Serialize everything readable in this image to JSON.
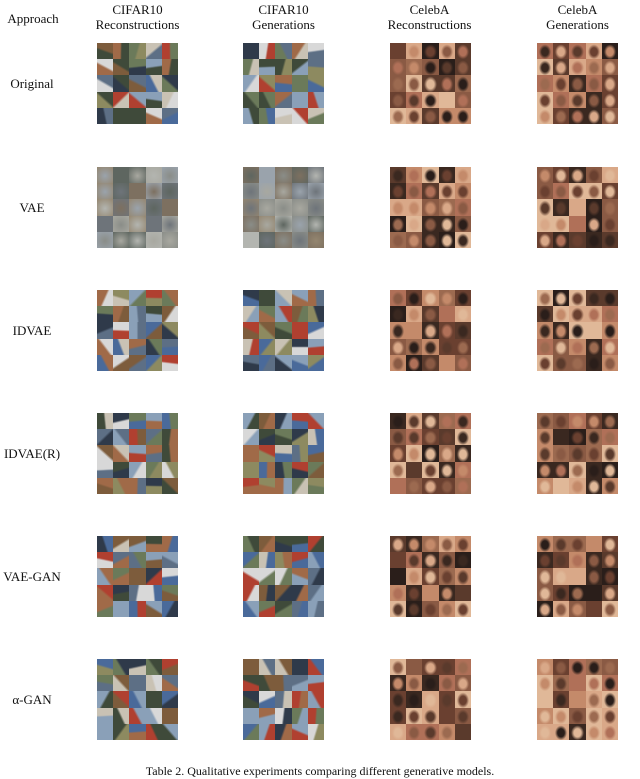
{
  "table": {
    "caption": "Table 2. Qualitative experiments comparing different generative models.",
    "headers": {
      "approach": "Approach",
      "columns": [
        {
          "line1": "CIFAR10",
          "line2": "Reconstructions"
        },
        {
          "line1": "CIFAR10",
          "line2": "Generations"
        },
        {
          "line1": "CelebA",
          "line2": "Reconstructions"
        },
        {
          "line1": "CelebA",
          "line2": "Generations"
        }
      ]
    },
    "rows": [
      {
        "label": "Original"
      },
      {
        "label": "VAE"
      },
      {
        "label": "IDVAE"
      },
      {
        "label": "IDVAE(R)"
      },
      {
        "label": "VAE-GAN"
      },
      {
        "label": "α-GAN"
      }
    ],
    "grid": {
      "rows": 5,
      "cols": 5,
      "cifar_description": "5x5 grid of CIFAR10 sample images",
      "celeba_description": "5x5 grid of CelebA face images"
    },
    "palettes": {
      "cifar": [
        "#6b7a5a",
        "#8aa0b8",
        "#a06a48",
        "#5d6f85",
        "#c9c2b4",
        "#3f4a3a",
        "#7d5c3c",
        "#b04030",
        "#d8d8d8",
        "#4a6a9a",
        "#8d8a60",
        "#2f3a4a"
      ],
      "cifar_blur": [
        "#8a8d88",
        "#9aa3ac",
        "#7d7060",
        "#a8a8a0",
        "#6e747a",
        "#948670",
        "#b3b5b0",
        "#5e6660"
      ],
      "celeba": [
        "#6a4030",
        "#c48a6a",
        "#3a2820",
        "#d9a888",
        "#8a5a44",
        "#b07058",
        "#2a1e1a",
        "#e0b898",
        "#9c6a50",
        "#5a3a2c"
      ]
    }
  }
}
